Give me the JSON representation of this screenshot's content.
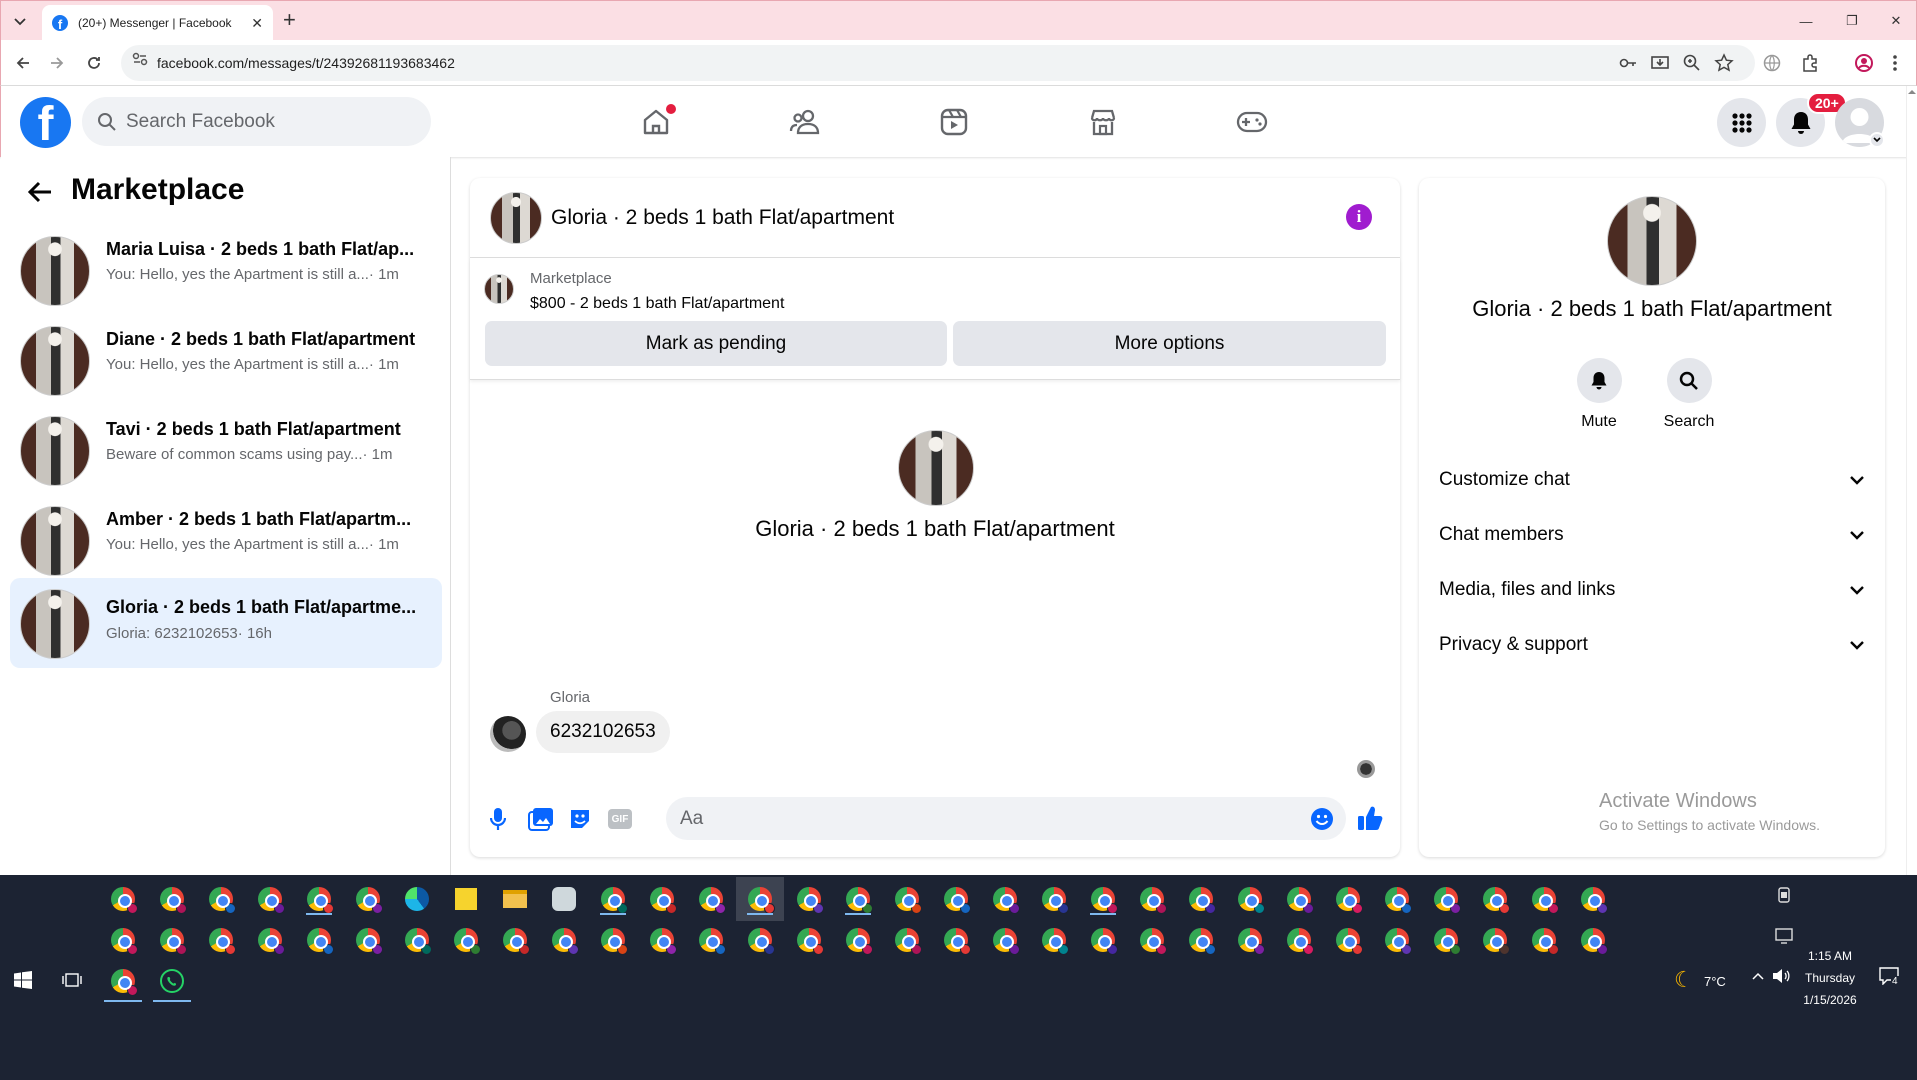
{
  "browser": {
    "tab_title": "(20+) Messenger | Facebook",
    "url": "facebook.com/messages/t/24392681193683462",
    "new_tab_symbol": "+",
    "window_controls": [
      "—",
      "❐",
      "✕"
    ]
  },
  "facebook_header": {
    "logo_letter": "f",
    "search_placeholder": "Search Facebook",
    "nav_items": [
      "home-icon",
      "friends-icon",
      "video-icon",
      "marketplace-icon",
      "gaming-icon"
    ],
    "notification_badge": "20+",
    "colors": {
      "brand": "#1877f2",
      "badge": "#e41e3f"
    }
  },
  "sidebar": {
    "title": "Marketplace",
    "conversations": [
      {
        "name": "Maria Luisa · 2 beds 1 bath Flat/ap...",
        "snippet": "You: Hello, yes the Apartment is still a...",
        "time": "· 1m"
      },
      {
        "name": "Diane · 2 beds 1 bath Flat/apartment",
        "snippet": "You: Hello, yes the Apartment is still a...",
        "time": "· 1m"
      },
      {
        "name": "Tavi · 2 beds 1 bath Flat/apartment",
        "snippet": "Beware of common scams using pay...",
        "time": "· 1m"
      },
      {
        "name": "Amber · 2 beds 1 bath Flat/apartm...",
        "snippet": "You: Hello, yes the Apartment is still a...",
        "time": "· 1m"
      },
      {
        "name": "Gloria · 2 beds 1 bath Flat/apartme...",
        "snippet": "Gloria: 6232102653",
        "time": " · 16h"
      }
    ]
  },
  "chat": {
    "title": "Gloria · 2 beds 1 bath Flat/apartment",
    "info_letter": "i",
    "marketplace_label": "Marketplace",
    "listing": "$800 - 2 beds 1 bath Flat/apartment",
    "mark_pending_label": "Mark as pending",
    "more_options_label": "More options",
    "intro_name": "Gloria · 2 beds 1 bath Flat/apartment",
    "messages": [
      {
        "sender": "Gloria",
        "text": "6232102653"
      }
    ],
    "composer_placeholder": "Aa",
    "gif_label": "GIF"
  },
  "info_panel": {
    "name": "Gloria · 2 beds 1 bath Flat/apartment",
    "actions": [
      {
        "label": "Mute",
        "icon": "bell-icon"
      },
      {
        "label": "Search",
        "icon": "search-icon"
      }
    ],
    "sections": [
      "Customize chat",
      "Chat members",
      "Media, files and links",
      "Privacy & support"
    ],
    "watermark_line1": "Activate Windows",
    "watermark_line2": "Go to Settings to activate Windows."
  },
  "taskbar": {
    "weather_temp": "7°C",
    "time": "1:15 AM",
    "day": "Thursday",
    "date": "1/15/2026",
    "notification_count": "4"
  }
}
